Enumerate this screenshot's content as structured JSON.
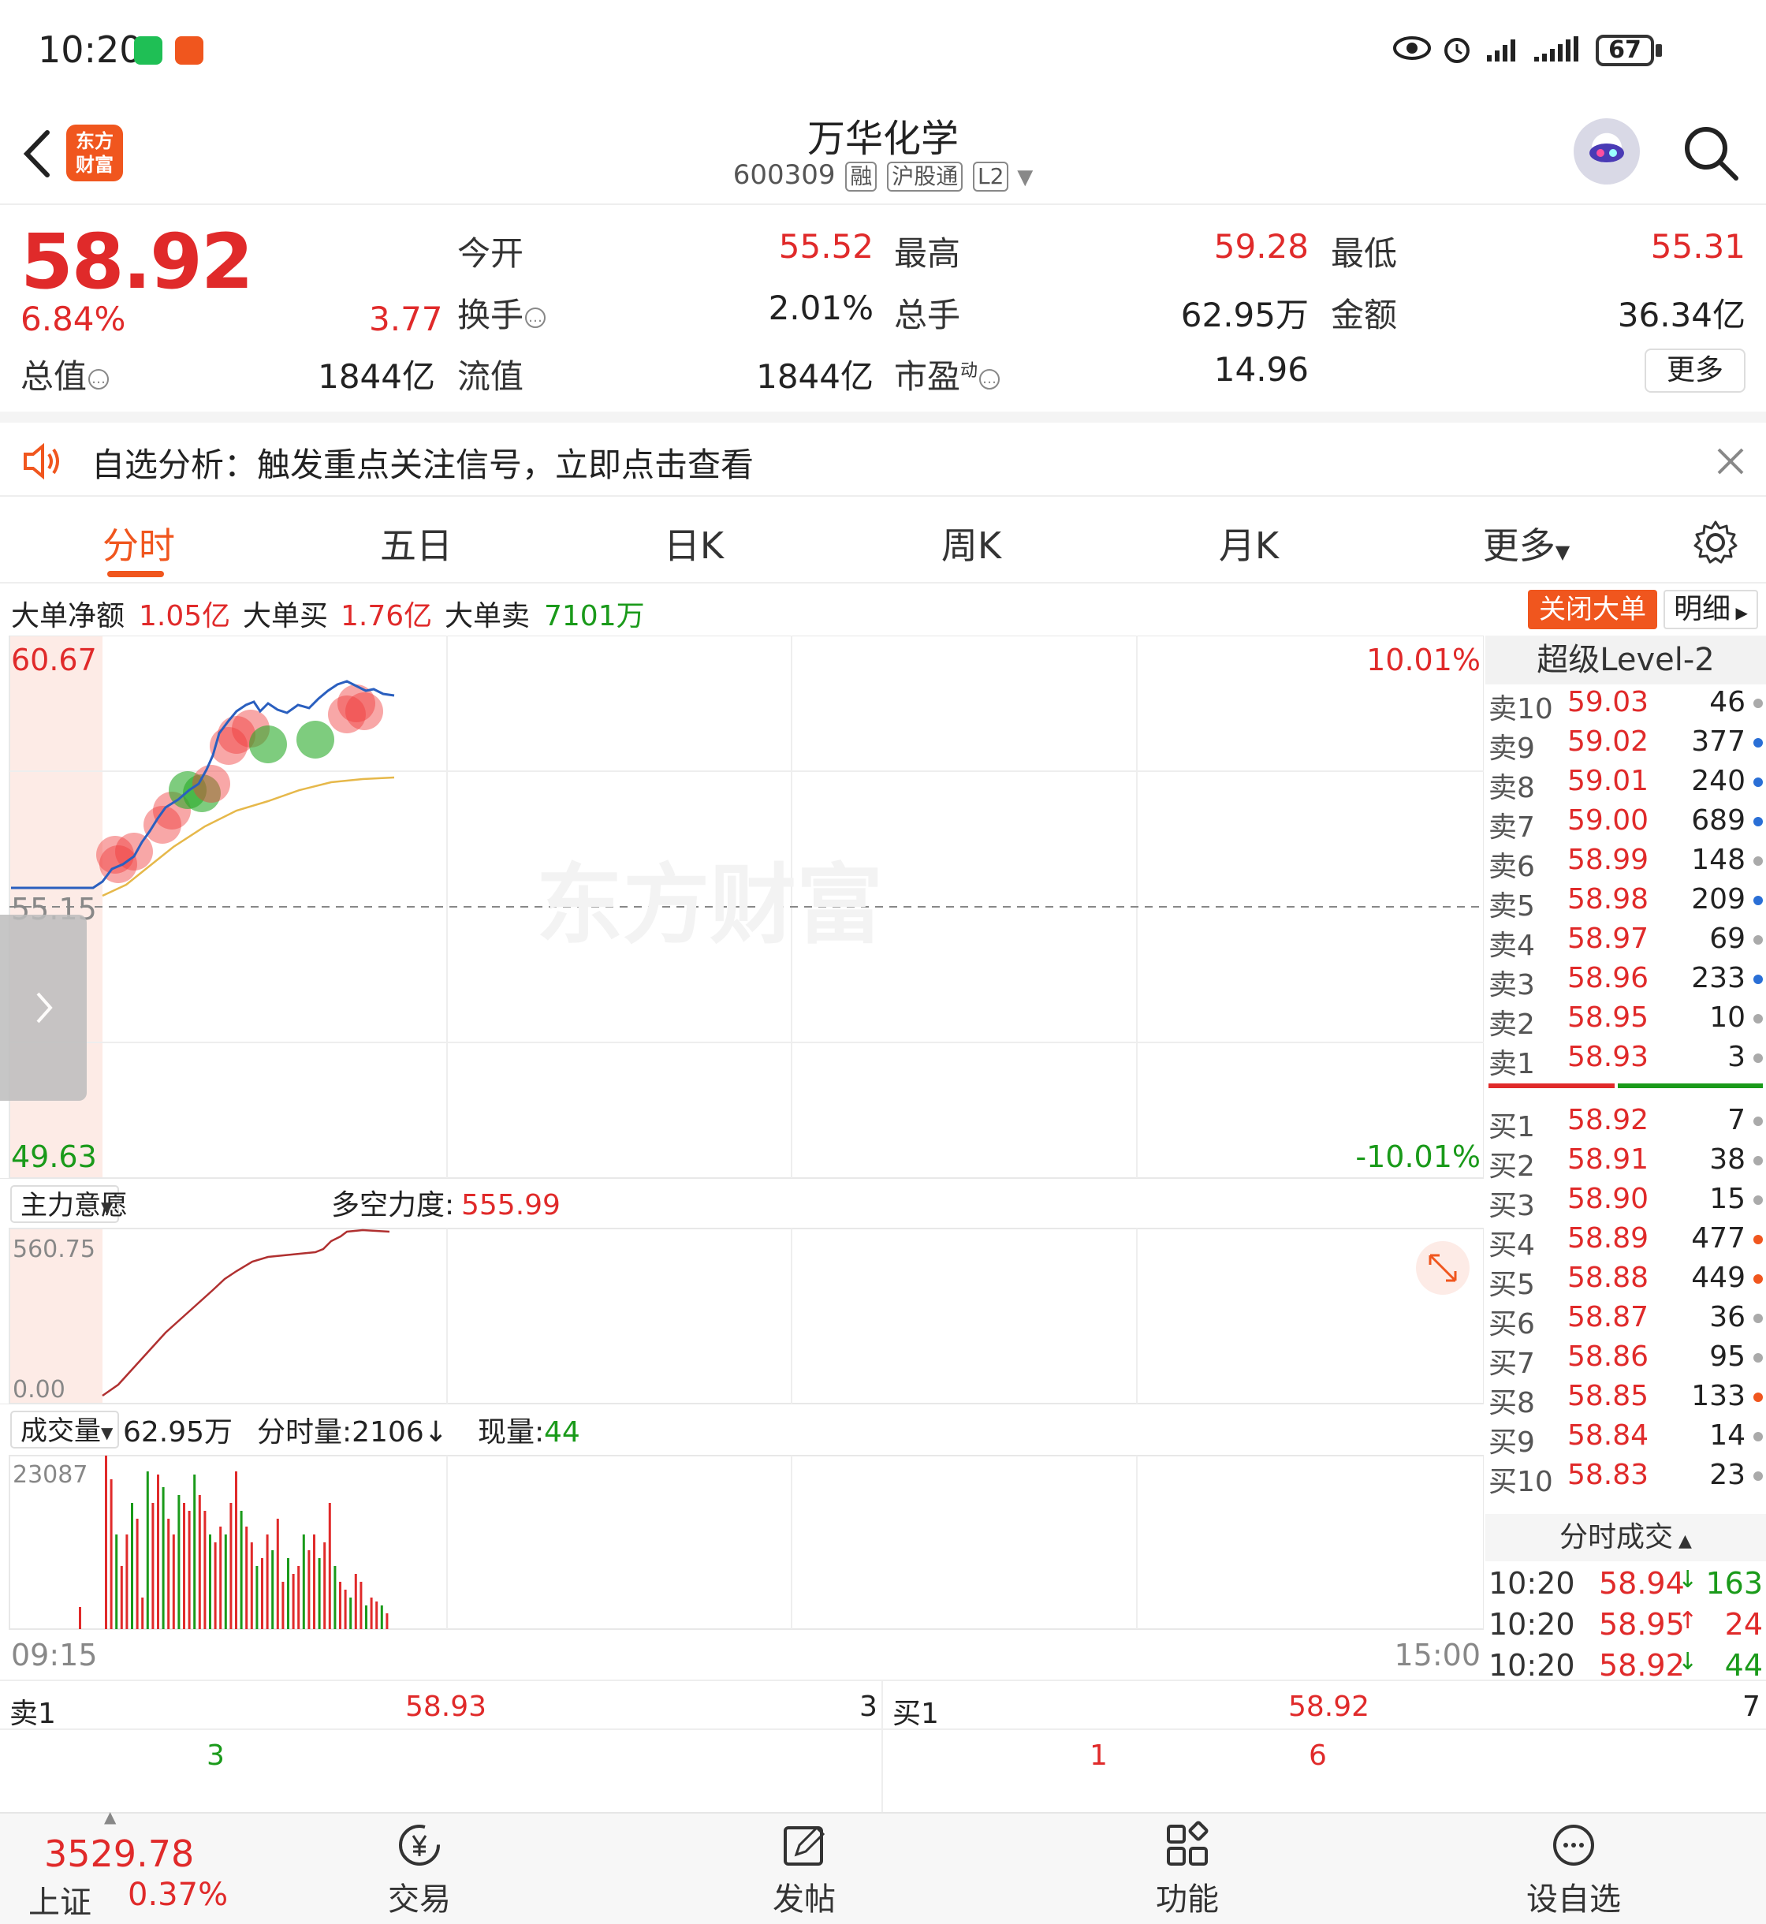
{
  "status_bar": {
    "time": "10:20",
    "battery": "67"
  },
  "header": {
    "stock_name": "万华化学",
    "stock_code": "600309",
    "tags": [
      "融",
      "沪股通",
      "L2"
    ],
    "logo_text": "东方财富"
  },
  "quote": {
    "price": "58.92",
    "change_pct": "6.84%",
    "change": "3.77",
    "open_label": "今开",
    "open": "55.52",
    "high_label": "最高",
    "high": "59.28",
    "low_label": "最低",
    "low": "55.31",
    "turnover_label": "换手",
    "turnover": "2.01%",
    "volume_label": "总手",
    "volume": "62.95万",
    "amount_label": "金额",
    "amount": "36.34亿",
    "mktcap_label": "总值",
    "mktcap": "1844亿",
    "float_label": "流值",
    "float_cap": "1844亿",
    "pe_label": "市盈",
    "pe_sup": "动",
    "pe": "14.96",
    "more": "更多"
  },
  "notice": {
    "text": "自选分析：触发重点关注信号，立即点击查看"
  },
  "tabs": [
    "分时",
    "五日",
    "日K",
    "周K",
    "月K",
    "更多"
  ],
  "big_order": {
    "net_label": "大单净额",
    "net": "1.05亿",
    "buy_label": "大单买",
    "buy": "1.76亿",
    "sell_label": "大单卖",
    "sell": "7101万",
    "close_btn": "关闭大单",
    "detail_btn": "明细"
  },
  "chart_labels": {
    "y_top": "60.67",
    "y_mid": "55.15",
    "y_bottom": "49.63",
    "pct_top": "10.01%",
    "pct_bottom": "-10.01%",
    "watermark": "东方财富",
    "sub_indicator": "主力意愿",
    "sub_title": "多空力度:",
    "sub_value": "555.99",
    "sub_top": "560.75",
    "sub_bottom": "0.00",
    "vol_indicator": "成交量",
    "vol_total": "62.95万",
    "vol_min_label": "分时量:2106↓",
    "vol_now_label": "现量:",
    "vol_now": "44",
    "vol_top": "23087",
    "x_start": "09:15",
    "x_end": "15:00"
  },
  "orderbook": {
    "title": "超级Level-2",
    "sells": [
      {
        "label": "卖10",
        "price": "59.03",
        "qty": "46",
        "dot": "#aaaaaa"
      },
      {
        "label": "卖9",
        "price": "59.02",
        "qty": "377",
        "dot": "#2a6fd6"
      },
      {
        "label": "卖8",
        "price": "59.01",
        "qty": "240",
        "dot": "#2a6fd6"
      },
      {
        "label": "卖7",
        "price": "59.00",
        "qty": "689",
        "dot": "#2a6fd6"
      },
      {
        "label": "卖6",
        "price": "58.99",
        "qty": "148",
        "dot": "#aaaaaa"
      },
      {
        "label": "卖5",
        "price": "58.98",
        "qty": "209",
        "dot": "#2a6fd6"
      },
      {
        "label": "卖4",
        "price": "58.97",
        "qty": "69",
        "dot": "#aaaaaa"
      },
      {
        "label": "卖3",
        "price": "58.96",
        "qty": "233",
        "dot": "#2a6fd6"
      },
      {
        "label": "卖2",
        "price": "58.95",
        "qty": "10",
        "dot": "#aaaaaa"
      },
      {
        "label": "卖1",
        "price": "58.93",
        "qty": "3",
        "dot": "#aaaaaa"
      }
    ],
    "buys": [
      {
        "label": "买1",
        "price": "58.92",
        "qty": "7",
        "dot": "#aaaaaa"
      },
      {
        "label": "买2",
        "price": "58.91",
        "qty": "38",
        "dot": "#aaaaaa"
      },
      {
        "label": "买3",
        "price": "58.90",
        "qty": "15",
        "dot": "#aaaaaa"
      },
      {
        "label": "买4",
        "price": "58.89",
        "qty": "477",
        "dot": "#f0561e"
      },
      {
        "label": "买5",
        "price": "58.88",
        "qty": "449",
        "dot": "#f0561e"
      },
      {
        "label": "买6",
        "price": "58.87",
        "qty": "36",
        "dot": "#aaaaaa"
      },
      {
        "label": "买7",
        "price": "58.86",
        "qty": "95",
        "dot": "#aaaaaa"
      },
      {
        "label": "买8",
        "price": "58.85",
        "qty": "133",
        "dot": "#f0561e"
      },
      {
        "label": "买9",
        "price": "58.84",
        "qty": "14",
        "dot": "#aaaaaa"
      },
      {
        "label": "买10",
        "price": "58.83",
        "qty": "23",
        "dot": "#aaaaaa"
      }
    ],
    "trades_title": "分时成交",
    "trades": [
      {
        "time": "10:20",
        "price": "58.94",
        "dir": "↓",
        "qty": "163",
        "color": "#1a9a1a"
      },
      {
        "time": "10:20",
        "price": "58.95",
        "dir": "↑",
        "qty": "24",
        "color": "#e02a2a"
      },
      {
        "time": "10:20",
        "price": "58.92",
        "dir": "↓",
        "qty": "44",
        "color": "#1a9a1a"
      }
    ]
  },
  "l1": {
    "sell_label": "卖1",
    "sell_price": "58.93",
    "sell_qty": "3",
    "sell_sub": "3",
    "buy_label": "买1",
    "buy_price": "58.92",
    "buy_qty": "7",
    "buy_sub1": "1",
    "buy_sub2": "6"
  },
  "bottom_nav": {
    "index_value": "3529.78",
    "index_name": "上证",
    "index_pct": "0.37%",
    "items": [
      "交易",
      "发帖",
      "功能",
      "设自选"
    ]
  },
  "colors": {
    "up": "#e02a2a",
    "down": "#1a9a1a",
    "brand": "#f0561e",
    "price_line": "#2a5fbf",
    "avg_line": "#e6b84a"
  }
}
